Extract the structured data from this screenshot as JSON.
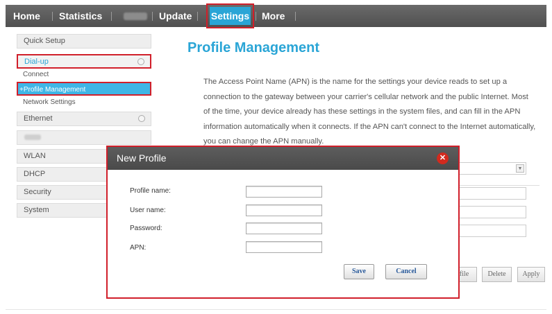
{
  "nav": {
    "items": [
      "Home",
      "Statistics",
      "Update",
      "Settings",
      "More"
    ]
  },
  "sidebar": {
    "quick_setup": "Quick Setup",
    "dial_up": "Dial-up",
    "connect": "Connect",
    "profile_management": "+Profile Management",
    "network_settings": "Network Settings",
    "ethernet": "Ethernet",
    "wlan": "WLAN",
    "dhcp": "DHCP",
    "security": "Security",
    "system": "System"
  },
  "main": {
    "title": "Profile Management",
    "description": "The Access Point Name (APN) is the name for the settings your device reads to set up a connection to the gateway between your carrier's cellular network and the public Internet. Most of the time, your device already has these settings in the system files, and can fill in the APN information automatically when it connects. If the APN can't connect to the Internet automatically, you can change the APN manually.",
    "profile_btn_partial": "file",
    "delete_label": "Delete",
    "apply_label": "Apply"
  },
  "dialog": {
    "title": "New Profile",
    "close_icon": "close-icon",
    "fields": {
      "profile_name": {
        "label": "Profile name:",
        "value": ""
      },
      "user_name": {
        "label": "User name:",
        "value": ""
      },
      "password": {
        "label": "Password:",
        "value": ""
      },
      "apn": {
        "label": "APN:",
        "value": ""
      }
    },
    "save_label": "Save",
    "cancel_label": "Cancel"
  },
  "colors": {
    "accent": "#2aa5d6",
    "highlight_border": "#d11f2a",
    "nav_bg": "#5a5a5a",
    "close_button": "#d22a1e"
  }
}
